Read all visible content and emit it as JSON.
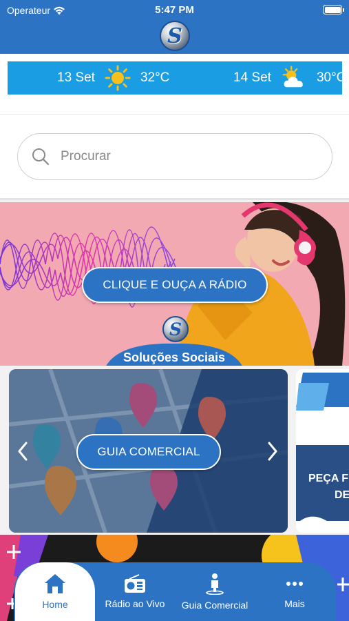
{
  "status_bar": {
    "carrier": "Operateur",
    "time": "5:47 PM"
  },
  "weather": [
    {
      "date": "13 Set",
      "temp": "32°C",
      "icon": "sun-icon"
    },
    {
      "date": "14 Set",
      "temp": "30°C",
      "icon": "sun-cloud-icon"
    }
  ],
  "search": {
    "placeholder": "Procurar"
  },
  "banners": {
    "radio": {
      "button_label": "CLIQUE E OUÇA A RÁDIO",
      "brand": "Soluções Sociais"
    },
    "guide": {
      "button_label": "GUIA COMERCIAL",
      "next_card_text_1": "PEÇA F",
      "next_card_text_2": "DE"
    }
  },
  "tabbar": {
    "items": [
      {
        "label": "Home",
        "icon": "home-icon",
        "active": true
      },
      {
        "label": "Rádio ao Vivo",
        "icon": "radio-icon",
        "active": false
      },
      {
        "label": "Guia Comercial",
        "icon": "person-icon",
        "active": false
      },
      {
        "label": "Mais",
        "icon": "more-icon",
        "active": false
      }
    ]
  },
  "colors": {
    "brand_blue": "#2d73c3",
    "weather_blue": "#1b9de3",
    "banner_pink": "#f2a9b2",
    "sun_yellow": "#f7c01a"
  }
}
